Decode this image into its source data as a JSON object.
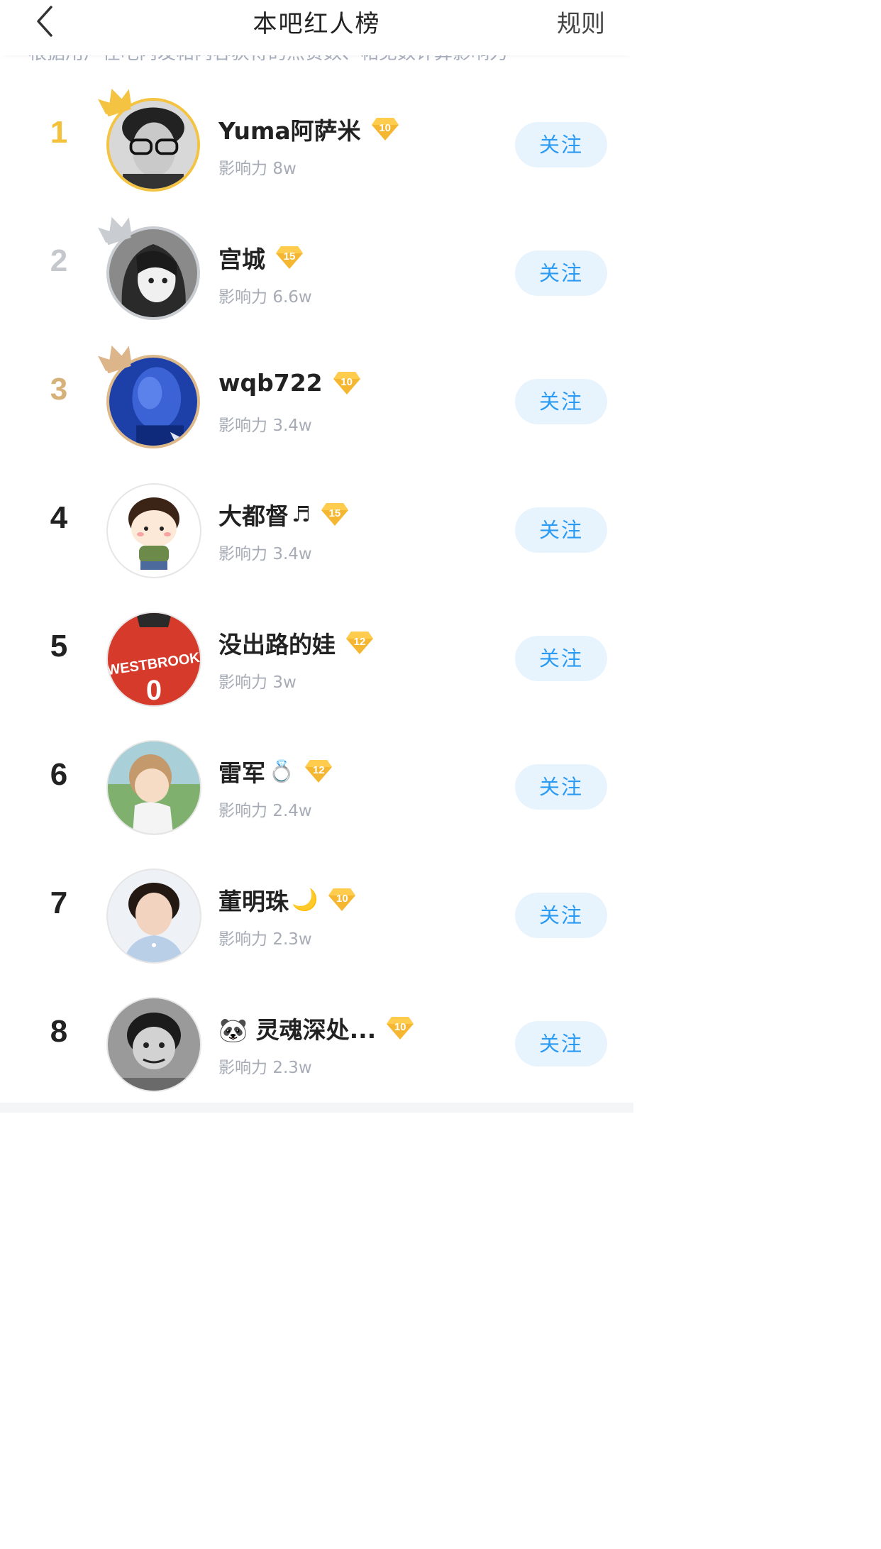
{
  "header": {
    "title": "本吧红人榜",
    "rules_label": "规则",
    "subtitle": "根据用户在吧内发帖内容获得的点赞数、帖见数计算影响力"
  },
  "influence_label": "影响力",
  "follow_label": "关注",
  "colors": {
    "gold": "#f4c13a",
    "silver": "#c4c7cc",
    "bronze": "#d6b27a",
    "follow_bg": "#e8f4fd",
    "follow_text": "#2b9af3",
    "badge": "#f5b731"
  },
  "users": [
    {
      "rank": "1",
      "name": "Yuma阿萨米",
      "emoji": "",
      "level": "10",
      "influence": "8w",
      "medal": "gold",
      "avatar": "person-glasses"
    },
    {
      "rank": "2",
      "name": "宫城",
      "emoji": "",
      "level": "15",
      "influence": "6.6w",
      "medal": "silver",
      "avatar": "anime-girl"
    },
    {
      "rank": "3",
      "name": "wqb722",
      "emoji": "",
      "level": "10",
      "influence": "3.4w",
      "medal": "bronze",
      "avatar": "blue-portrait"
    },
    {
      "rank": "4",
      "name": "大都督",
      "emoji": "♬",
      "level": "15",
      "influence": "3.4w",
      "medal": "",
      "avatar": "cartoon-boy"
    },
    {
      "rank": "5",
      "name": "没出路的娃",
      "emoji": "",
      "level": "12",
      "influence": "3w",
      "medal": "",
      "avatar": "jersey"
    },
    {
      "rank": "6",
      "name": "雷军",
      "emoji": "💍",
      "level": "12",
      "influence": "2.4w",
      "medal": "",
      "avatar": "anime-boy"
    },
    {
      "rank": "7",
      "name": "董明珠",
      "emoji": "🌙",
      "level": "10",
      "influence": "2.3w",
      "medal": "",
      "avatar": "woman-portrait"
    },
    {
      "rank": "8",
      "name": "🐼 灵魂深处...",
      "emoji": "",
      "level": "10",
      "influence": "2.3w",
      "medal": "",
      "avatar": "manga-face"
    }
  ]
}
